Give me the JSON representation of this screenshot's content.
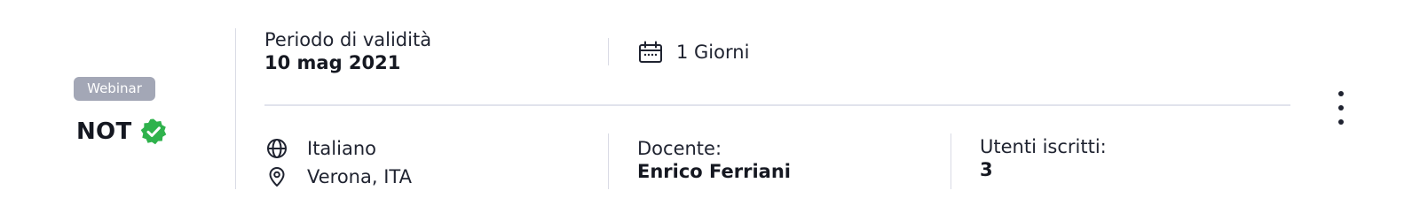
{
  "course": {
    "type_badge": "Webinar",
    "code": "NOT",
    "verified_icon": "verified-badge-icon",
    "verified_color": "#2fb24c"
  },
  "validity": {
    "label": "Periodo di validità",
    "value": "10 mag 2021"
  },
  "duration": {
    "icon": "calendar-icon",
    "text": "1 Giorni"
  },
  "language": {
    "icon": "globe-icon",
    "text": "Italiano"
  },
  "location": {
    "icon": "location-pin-icon",
    "text": "Verona, ITA"
  },
  "teacher": {
    "label": "Docente:",
    "value": "Enrico Ferriani"
  },
  "users": {
    "label": "Utenti iscritti:",
    "value": "3"
  },
  "menu": {
    "icon": "more-vertical-icon"
  }
}
